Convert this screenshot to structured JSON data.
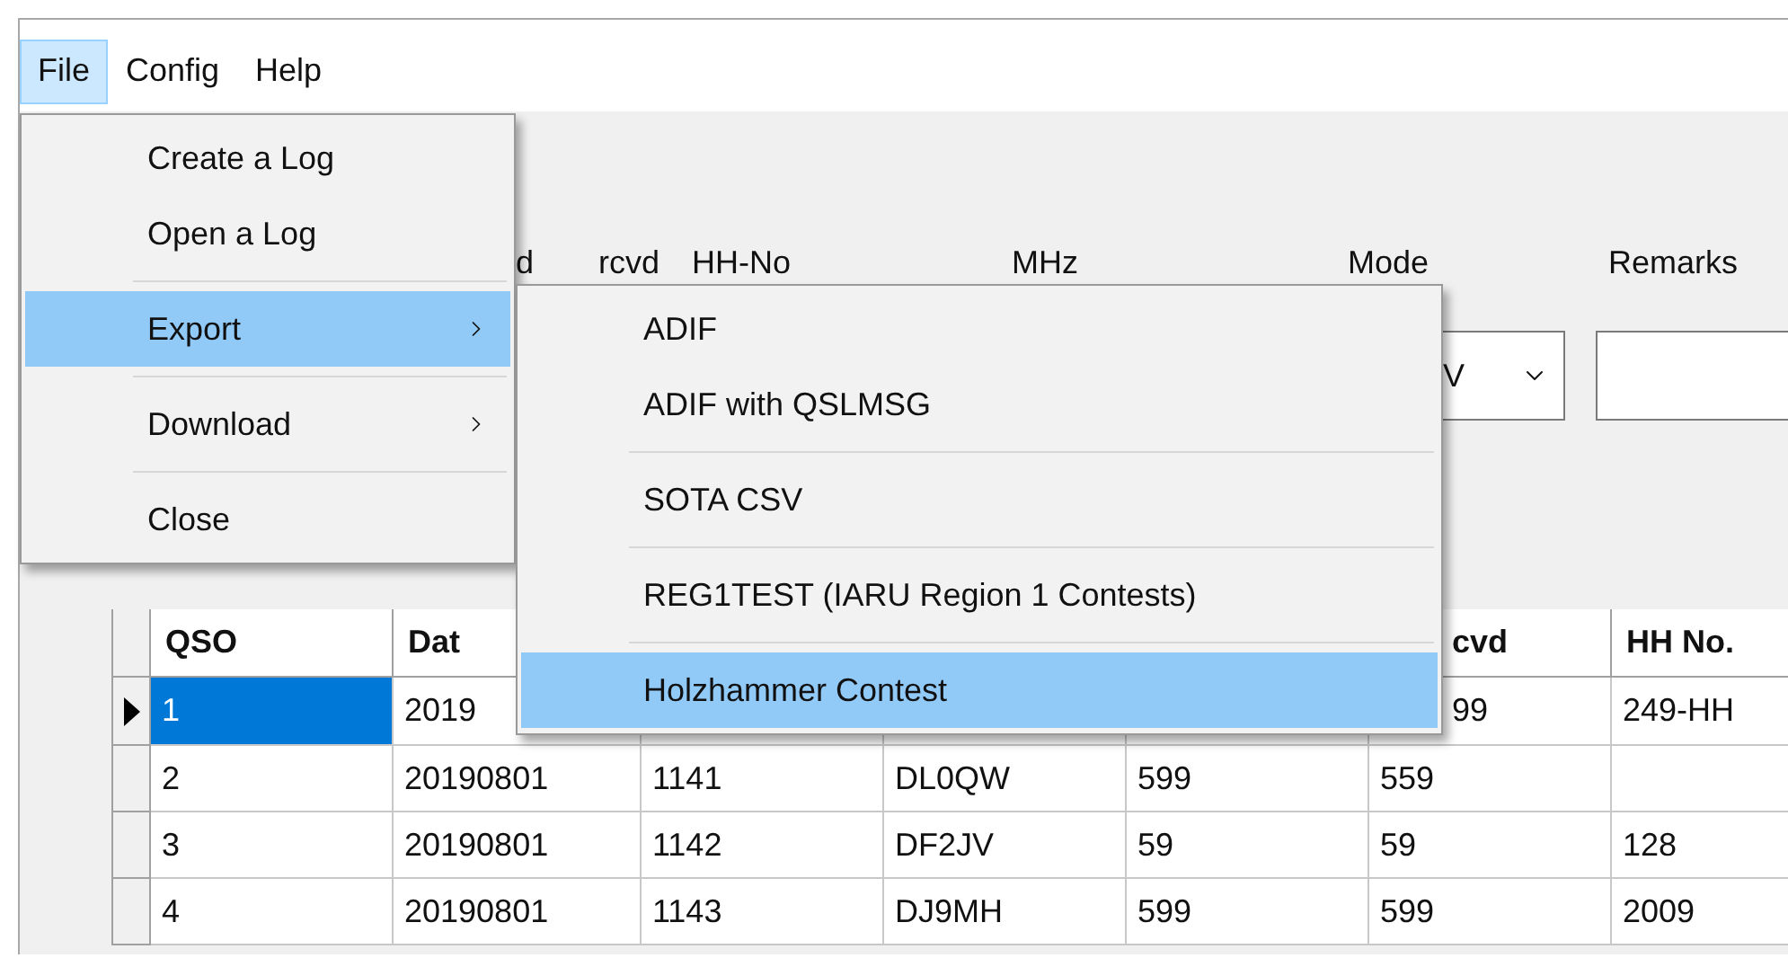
{
  "menu_bar": [
    {
      "label": "File",
      "selected": true
    },
    {
      "label": "Config",
      "selected": false
    },
    {
      "label": "Help",
      "selected": false
    }
  ],
  "form": {
    "labels": [
      "d",
      "rcvd",
      "HH-No",
      "MHz",
      "Mode",
      "Remarks"
    ],
    "mode_value": "V"
  },
  "file_menu": [
    {
      "kind": "item",
      "label": "Create a Log",
      "submenu": false,
      "selected": false
    },
    {
      "kind": "item",
      "label": "Open a Log",
      "submenu": false,
      "selected": false
    },
    {
      "kind": "separator"
    },
    {
      "kind": "item",
      "label": "Export",
      "submenu": true,
      "selected": true
    },
    {
      "kind": "separator"
    },
    {
      "kind": "item",
      "label": "Download",
      "submenu": true,
      "selected": false
    },
    {
      "kind": "separator"
    },
    {
      "kind": "item",
      "label": "Close",
      "submenu": false,
      "selected": false
    }
  ],
  "export_submenu": [
    {
      "kind": "item",
      "label": "ADIF",
      "selected": false
    },
    {
      "kind": "item",
      "label": "ADIF with QSLMSG",
      "selected": false
    },
    {
      "kind": "separator"
    },
    {
      "kind": "item",
      "label": "SOTA CSV",
      "selected": false
    },
    {
      "kind": "separator"
    },
    {
      "kind": "item",
      "label": "REG1TEST (IARU Region 1 Contests)",
      "selected": false
    },
    {
      "kind": "separator"
    },
    {
      "kind": "item",
      "label": "Holzhammer Contest",
      "selected": true
    }
  ],
  "table": {
    "columns": [
      "QSO",
      "Dat",
      null,
      null,
      null,
      "cvd",
      "HH No."
    ],
    "rows": [
      {
        "cells": [
          "1",
          "2019",
          null,
          null,
          null,
          "99",
          "249-HH"
        ],
        "selected": true
      },
      {
        "cells": [
          "2",
          "20190801",
          "1141",
          "DL0QW",
          "599",
          "559",
          null
        ],
        "selected": false
      },
      {
        "cells": [
          "3",
          "20190801",
          "1142",
          "DF2JV",
          "59",
          "59",
          "128"
        ],
        "selected": false
      },
      {
        "cells": [
          "4",
          "20190801",
          "1143",
          "DJ9MH",
          "599",
          "599",
          "2009"
        ],
        "selected": false
      }
    ]
  }
}
